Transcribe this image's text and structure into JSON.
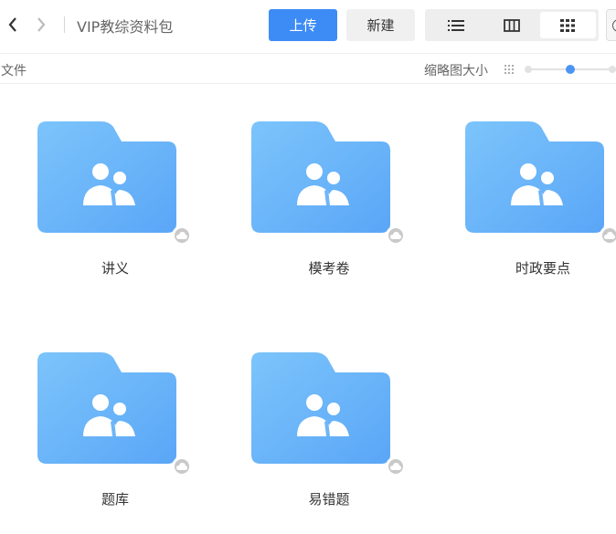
{
  "toolbar": {
    "path_title": "VIP教综资料包",
    "upload_label": "上传",
    "new_label": "新建",
    "view_mode": "thumbnail"
  },
  "subbar": {
    "crumb_label": "文件",
    "thumb_size_label": "缩略图大小",
    "thumb_size_level": 0.5
  },
  "colors": {
    "accent": "#3d8cf5",
    "folder_light": "#7cc4fb",
    "folder_dark": "#5aa6f7"
  },
  "files": [
    {
      "name": "讲义",
      "icon": "shared-folder-icon",
      "status_icon": "cloud-icon"
    },
    {
      "name": "模考卷",
      "icon": "shared-folder-icon",
      "status_icon": "cloud-icon"
    },
    {
      "name": "时政要点",
      "icon": "shared-folder-icon",
      "status_icon": "cloud-icon"
    },
    {
      "name": "题库",
      "icon": "shared-folder-icon",
      "status_icon": "cloud-icon"
    },
    {
      "name": "易错题",
      "icon": "shared-folder-icon",
      "status_icon": "cloud-icon"
    }
  ]
}
